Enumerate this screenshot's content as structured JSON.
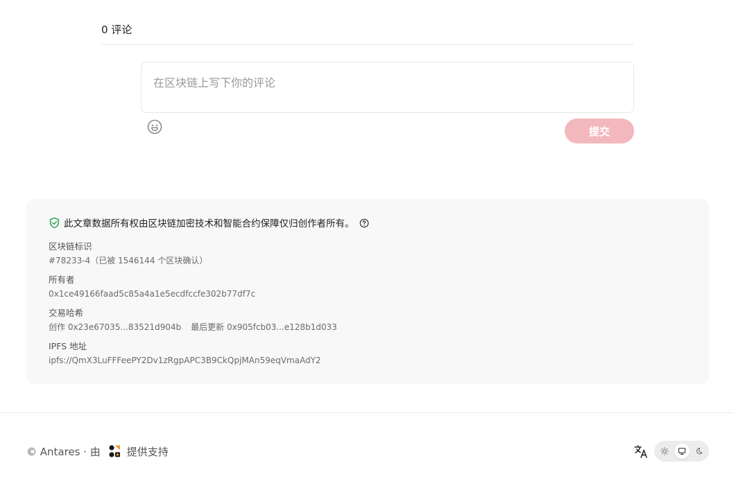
{
  "comments": {
    "count_label": "0 评论",
    "placeholder": "在区块链上写下你的评论",
    "submit_label": "提交",
    "emoji_icon": "smile-icon",
    "submit_color": "#f3b8bd"
  },
  "blockchain": {
    "notice": "此文章数据所有权由区块链加密技术和智能合约保障仅归创作者所有。",
    "notice_icon": "shield-check-icon",
    "help_icon": "help-circle-icon",
    "accent_color": "#2e9e5b",
    "fields": {
      "chain_id": {
        "label": "区块链标识",
        "value": "#78233-4（已被 1546144 个区块确认）"
      },
      "owner": {
        "label": "所有者",
        "value": "0x1ce49166faad5c85a4a1e5ecdfccfe302b77df7c"
      },
      "tx_hash": {
        "label": "交易哈希",
        "created": "创作 0x23e67035...83521d904b",
        "updated": "最后更新 0x905fcb03...e128b1d033"
      },
      "ipfs": {
        "label": "IPFS 地址",
        "value": "ipfs://QmX3LuFFFeePY2Dv1zRgpAPC3B9CkQpjMAn59eqVmaAdY2"
      }
    }
  },
  "footer": {
    "copyright": "© Antares · 由",
    "support": "提供支持",
    "brand_icon": "xlog-logo-icon",
    "translate_icon": "translate-icon",
    "theme_options": [
      "sun-icon",
      "monitor-icon",
      "moon-icon"
    ],
    "theme_selected": "monitor-icon"
  }
}
